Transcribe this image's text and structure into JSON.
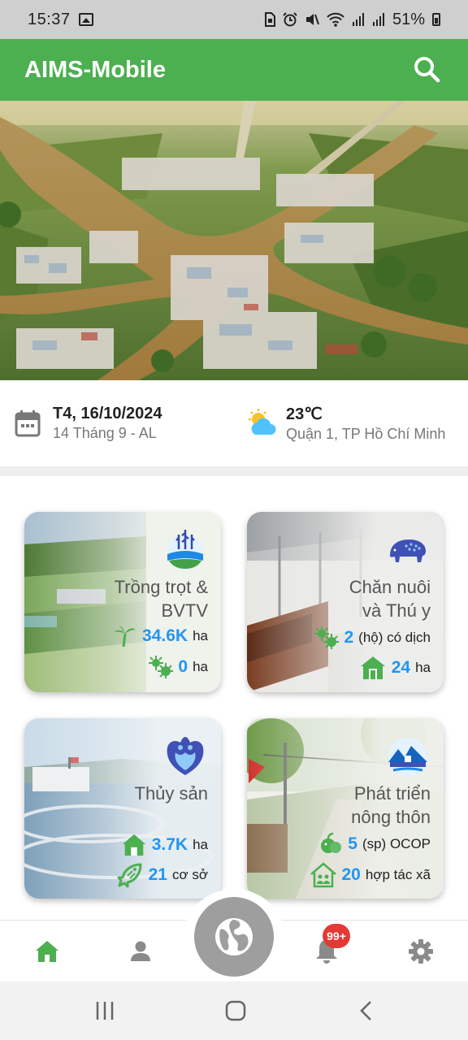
{
  "status_bar": {
    "time": "15:37",
    "battery": "51%",
    "icons": [
      "image-icon",
      "sim-icon",
      "alarm-icon",
      "mute-icon",
      "wifi-icon",
      "signal-icon",
      "signal-icon",
      "battery-icon"
    ]
  },
  "app_bar": {
    "title": "AIMS-Mobile",
    "search_icon": "search-icon"
  },
  "info": {
    "date": "T4, 16/10/2024",
    "lunar_date": "14 Tháng 9 - AL",
    "temperature": "23℃",
    "location": "Quận 1, TP Hồ Chí Minh"
  },
  "cards": [
    {
      "title_line1": "Trồng trọt &",
      "title_line2": "BVTV",
      "stat1_value": "34.6K",
      "stat1_unit": "ha",
      "stat2_value": "0",
      "stat2_unit": "ha"
    },
    {
      "title_line1": "Chăn nuôi",
      "title_line2": "và Thú y",
      "stat1_value": "2",
      "stat1_unit": "(hộ) có dịch",
      "stat2_value": "24",
      "stat2_unit": "ha"
    },
    {
      "title_line1": "Thủy sản",
      "stat1_value": "3.7K",
      "stat1_unit": "ha",
      "stat2_value": "21",
      "stat2_unit": "cơ sở"
    },
    {
      "title_line1": "Phát triển",
      "title_line2": "nông thôn",
      "stat1_value": "5",
      "stat1_unit": "(sp) OCOP",
      "stat2_value": "20",
      "stat2_unit": "hợp tác xã"
    }
  ],
  "bottom_nav": {
    "items": [
      "home-icon",
      "profile-icon",
      "globe-icon",
      "bell-icon",
      "settings-icon"
    ],
    "notification_badge": "99+",
    "active_color": "#4caf50",
    "inactive_color": "#8a8a8a"
  },
  "colors": {
    "primary": "#4caf50",
    "value_blue": "#2196f3",
    "icon_green": "#4caf50",
    "badge_red": "#e53935"
  }
}
